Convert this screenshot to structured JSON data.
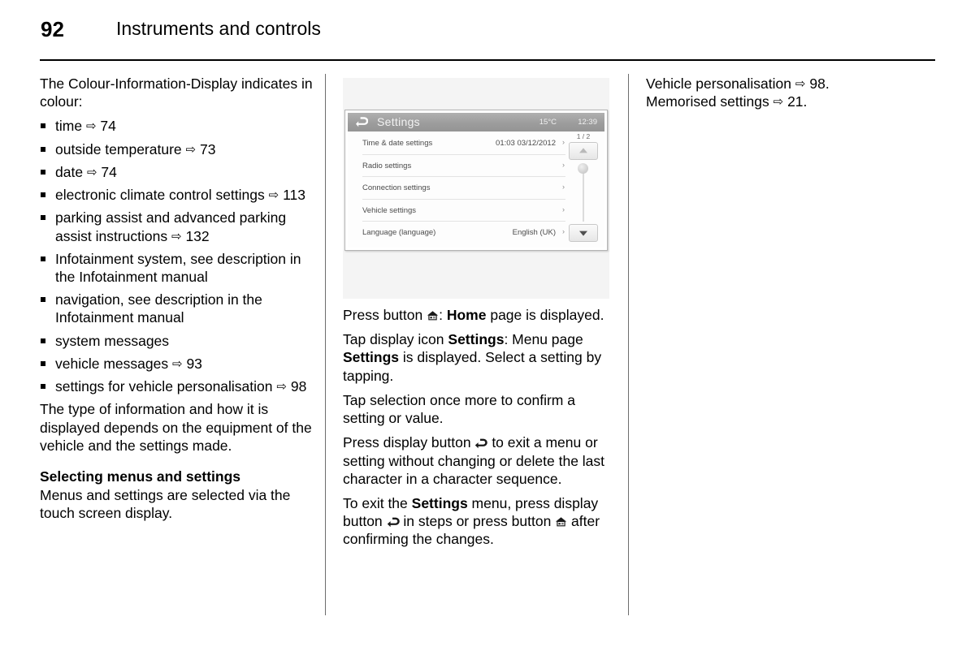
{
  "header": {
    "page_number": "92",
    "chapter_title": "Instruments and controls"
  },
  "left_column": {
    "intro": "The Colour-Information-Display indicates in colour:",
    "bullets": [
      {
        "text": "time",
        "ref": "74"
      },
      {
        "text": "outside temperature",
        "ref": "73"
      },
      {
        "text": "date",
        "ref": "74"
      },
      {
        "text": "electronic climate control settings",
        "ref": "113"
      },
      {
        "text": "parking assist and advanced parking assist instructions",
        "ref": "132"
      },
      {
        "text": "Infotainment system, see description in the Infotainment manual",
        "ref": ""
      },
      {
        "text": "navigation, see description in the Infotainment manual",
        "ref": ""
      },
      {
        "text": "system messages",
        "ref": ""
      },
      {
        "text": "vehicle messages",
        "ref": "93"
      },
      {
        "text": "settings for vehicle personalisation",
        "ref": "98"
      }
    ],
    "closing_paragraph": "The type of information and how it is displayed depends on the equipment of the vehicle and the settings made.",
    "subheading": "Selecting menus and settings",
    "subheading_paragraph": "Menus and settings are selected via the touch screen display."
  },
  "figure": {
    "device": {
      "title": "Settings",
      "back_icon": "back-arrow-icon",
      "temperature": "15°C",
      "clock": "12:39",
      "page_indicator": "1 / 2",
      "rows": [
        {
          "label": "Time & date settings",
          "value": "01:03  03/12/2012",
          "chevron": "›"
        },
        {
          "label": "Radio settings",
          "value": "",
          "chevron": "›"
        },
        {
          "label": "Connection settings",
          "value": "",
          "chevron": "›"
        },
        {
          "label": "Vehicle settings",
          "value": "",
          "chevron": "›"
        },
        {
          "label": "Language (language)",
          "value": "English (UK)",
          "chevron": "›"
        }
      ],
      "scroll_up_icon": "triangle-up-icon",
      "scroll_down_icon": "triangle-down-icon"
    }
  },
  "center_column": {
    "p1_a": "Press button ",
    "p1_b": ": ",
    "p1_home": "Home",
    "p1_c": " page is displayed.",
    "p2_a": "Tap display icon ",
    "p2_settings1": "Settings",
    "p2_b": ": Menu page ",
    "p2_settings2": "Settings",
    "p2_c": " is displayed. Select a setting by tapping.",
    "p3": "Tap selection once more to confirm a setting or value.",
    "p4_a": "Press display button ",
    "p4_b": " to exit a menu or setting without changing or delete the last character in a character sequence.",
    "p5_a": "To exit the ",
    "p5_settings": "Settings",
    "p5_b": " menu, press display button ",
    "p5_c": " in steps or press button ",
    "p5_d": " after confirming the changes."
  },
  "right_column": {
    "lines": [
      {
        "text": "Vehicle personalisation",
        "ref": "98",
        "suffix": "."
      },
      {
        "text": "Memorised settings",
        "ref": "21",
        "suffix": "."
      }
    ]
  },
  "colors": {
    "page_background": "#ffffff",
    "text": "#000000",
    "rule": "#000000",
    "divider": "#6d6d6d",
    "figure_background": "#f4f4f4",
    "device_titlebar": "#9d9d9d",
    "device_text": "#4a4a4a"
  }
}
